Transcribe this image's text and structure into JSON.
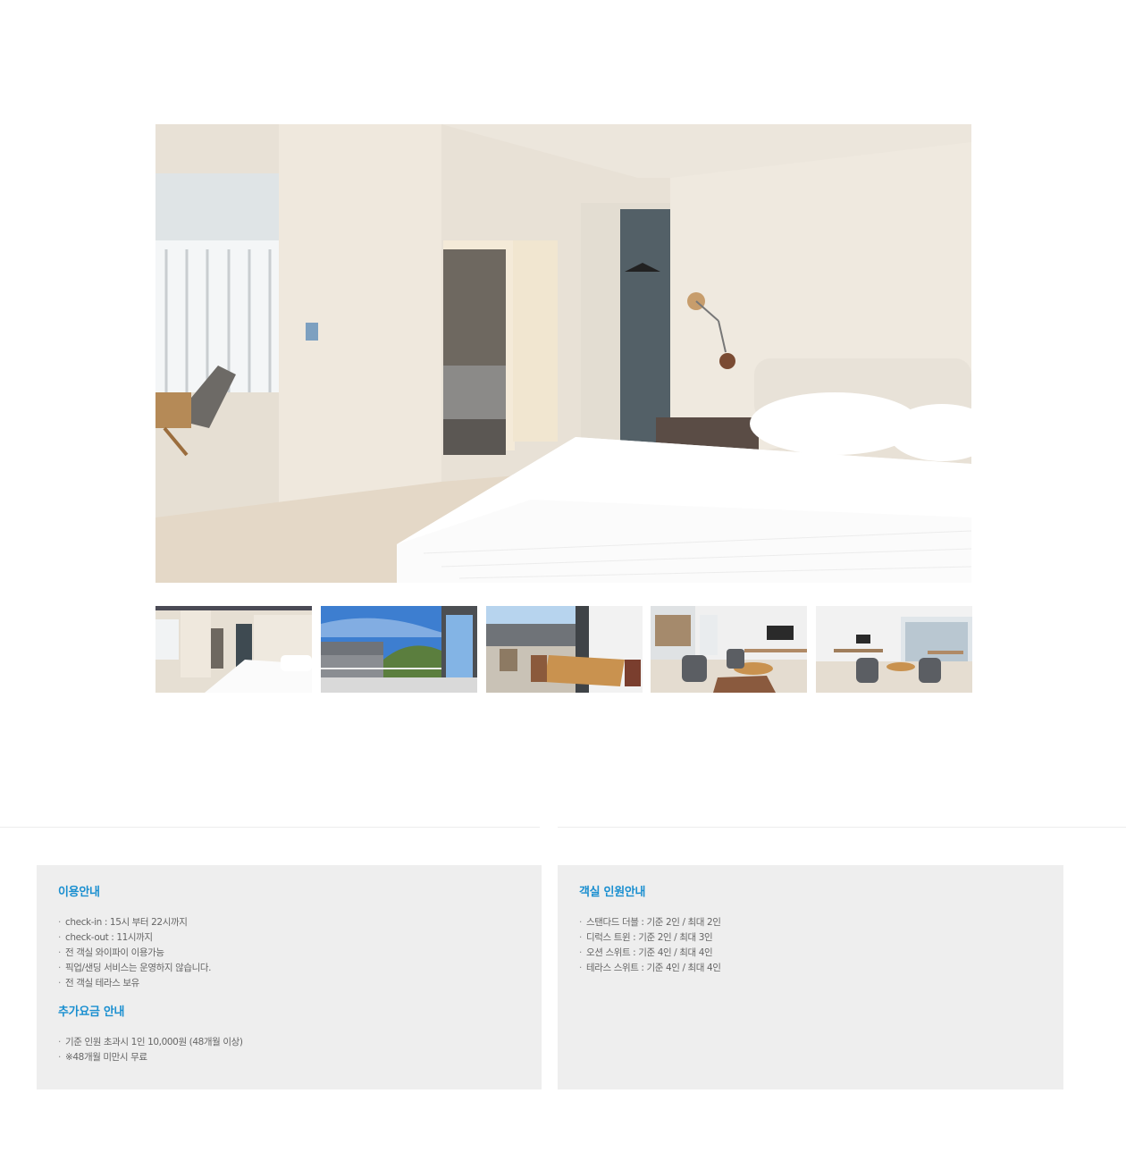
{
  "gallery": {
    "main_image": "bedroom-photo",
    "thumbnails": [
      {
        "name": "bedroom",
        "active": true
      },
      {
        "name": "terrace-view",
        "active": false
      },
      {
        "name": "terrace-dining",
        "active": false
      },
      {
        "name": "living-room",
        "active": false
      },
      {
        "name": "living-dining-room",
        "active": false
      }
    ]
  },
  "usage_info": {
    "title": "이용안내",
    "items": [
      "check-in : 15시 부터 22시까지",
      "check-out : 11시까지",
      "전 객실 와이파이 이용가능",
      "픽업/샌딩 서비스는 운영하지 않습니다.",
      "전 객실 테라스 보유"
    ]
  },
  "extra_fee": {
    "title": "추가요금 안내",
    "items": [
      "기준 인원 초과시 1인 10,000원 (48개월 이상)",
      "※48개월 미만시 무료"
    ]
  },
  "room_capacity": {
    "title": "객실 인원안내",
    "items": [
      "스탠다드 더블 : 기준 2인 / 최대 2인",
      "디럭스 트윈 : 기준 2인 / 최대 3인",
      "오션 스위트 : 기준 4인 / 최대 4인",
      "테라스 스위트 : 기준 4인 / 최대 4인"
    ]
  },
  "colors": {
    "accent": "#1a8fd0",
    "box_bg": "#eeeeee",
    "body_text": "#666666"
  }
}
